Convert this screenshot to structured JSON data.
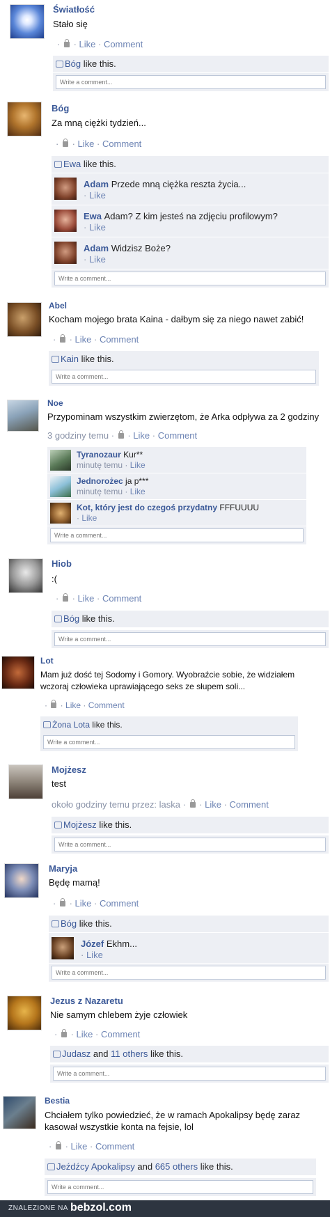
{
  "ui": {
    "like": "Like",
    "comment": "Comment",
    "write_placeholder": "Write a comment...",
    "like_suffix": "like this.",
    "and": "and",
    "sep": "·"
  },
  "posts": [
    {
      "name": "Światłość",
      "text": "Stało się",
      "meta": "",
      "likers": "Bóg",
      "comments": []
    },
    {
      "name": "Bóg",
      "text": "Za mną ciężki tydzień...",
      "meta": "",
      "likers": "Ewa",
      "comments": [
        {
          "name": "Adam",
          "text": "Przede mną ciężka reszta życia..."
        },
        {
          "name": "Ewa",
          "text": "Adam? Z kim jesteś na zdjęciu profilowym?"
        },
        {
          "name": "Adam",
          "text": "Widzisz Boże?"
        }
      ]
    },
    {
      "name": "Abel",
      "text": "Kocham mojego brata Kaina - dałbym się za niego nawet zabić!",
      "meta": "",
      "likers": "Kain",
      "comments": []
    },
    {
      "name": "Noe",
      "text": "Przypominam wszystkim zwierzętom, że Arka odpływa za 2 godziny",
      "meta": "3 godziny temu",
      "likers": "",
      "comments": [
        {
          "name": "Tyranozaur",
          "text": "Kur**",
          "time": "minutę temu"
        },
        {
          "name": "Jednorożec",
          "text": "ja p***",
          "time": "minutę temu"
        },
        {
          "name": "Kot, który jest do czegoś przydatny",
          "text": "FFFUUUU",
          "time": ""
        }
      ]
    },
    {
      "name": "Hiob",
      "text": ":(",
      "meta": "",
      "likers": "Bóg",
      "comments": []
    },
    {
      "name": "Lot",
      "text": "Mam już dość tej Sodomy i Gomory. Wyobraźcie sobie, że widziałem",
      "text2": "wczoraj człowieka uprawiającego seks ze słupem soli...",
      "meta": "",
      "likers": "Żona Lota",
      "comments": []
    },
    {
      "name": "Mojżesz",
      "text": "test",
      "meta": "około godziny temu przez: laska",
      "likers": "Mojżesz",
      "comments": []
    },
    {
      "name": "Maryja",
      "text": "Będę mamą!",
      "meta": "",
      "likers": "Bóg",
      "comments": [
        {
          "name": "Józef",
          "text": "Ekhm..."
        }
      ]
    },
    {
      "name": "Jezus z Nazaretu",
      "text": "Nie samym chlebem żyje człowiek",
      "meta": "",
      "likers": "Judasz",
      "likers_others": "11 others",
      "comments": []
    },
    {
      "name": "Bestia",
      "text": "Chciałem tylko powiedzieć, że w ramach Apokalipsy będę zaraz",
      "text2": "kasował wszystkie konta na fejsie, lol",
      "meta": "",
      "likers": "Jeźdźcy Apokalipsy",
      "likers_others": "665 others",
      "comments": []
    }
  ],
  "footer": {
    "label": "ZNALEZIONE NA",
    "brand": "bebzol.com"
  }
}
